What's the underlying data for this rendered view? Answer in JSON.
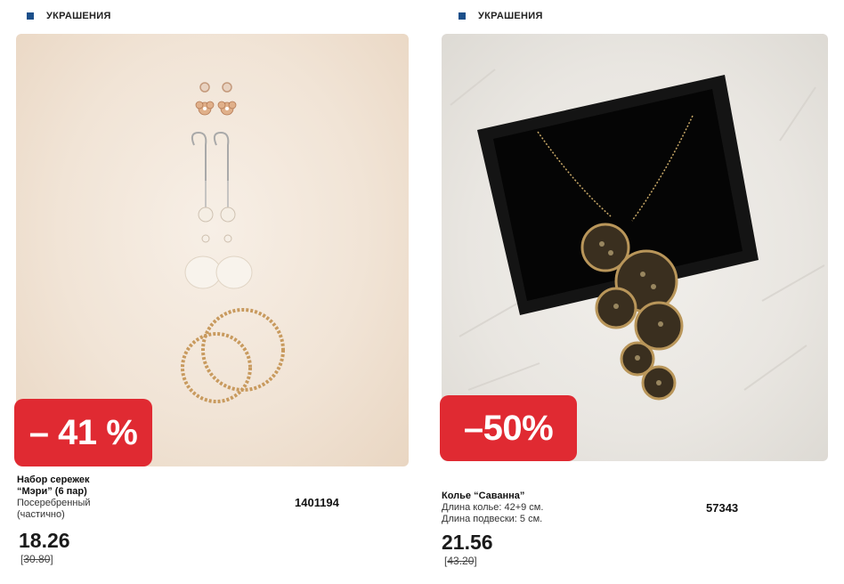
{
  "products": [
    {
      "category": "УКРАШЕНИЯ",
      "discount": "– 41 %",
      "name_line1": "Набор сережек",
      "name_line2": "“Мэри” (6 пар)",
      "desc_line1": "Посеребренный",
      "desc_line2": "(частично)",
      "code": "1401194",
      "price": "18.26",
      "old_price": "30.80",
      "image_icon": "earrings-set-photo"
    },
    {
      "category": "УКРАШЕНИЯ",
      "discount": "–50%",
      "name_line1": "Колье “Саванна”",
      "desc_line1": "Длина колье: 42+9 см.",
      "desc_line2": "Длина подвески: 5 см.",
      "code": "57343",
      "price": "21.56",
      "old_price": "43.20",
      "image_icon": "necklace-in-box-photo"
    }
  ],
  "colors": {
    "accent_dot": "#1b4f8a",
    "badge": "#e02a32"
  }
}
